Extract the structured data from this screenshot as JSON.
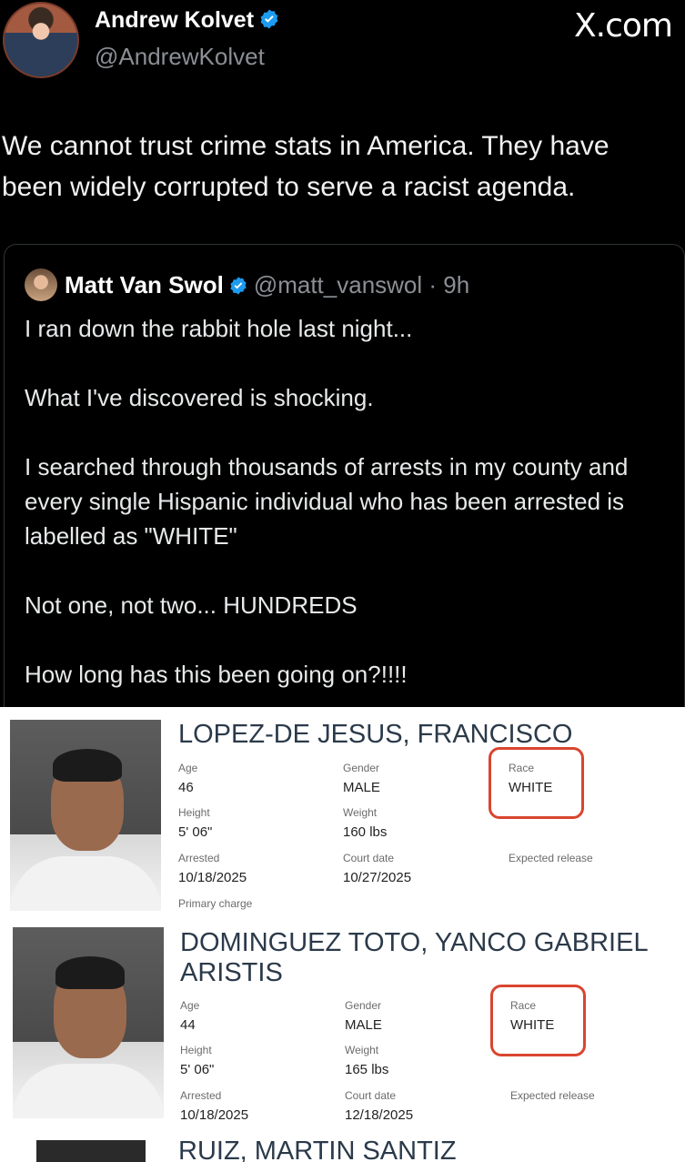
{
  "post": {
    "author_name": "Andrew Kolvet",
    "author_handle": "@AndrewKolvet",
    "brand": "X.com",
    "text_line1": "We cannot trust crime stats in America. They have",
    "text_line2": "been widely corrupted to serve a racist agenda."
  },
  "quote": {
    "author_name": "Matt Van Swol",
    "author_handle": "@matt_vanswol · 9h",
    "paragraphs": [
      "I ran down the rabbit hole last night...",
      "What I've discovered is shocking.",
      "I searched through thousands of arrests in my county and every single Hispanic individual who has been arrested is labelled as \"WHITE\"",
      "Not one, not two... HUNDREDS",
      "How long has this been going on?!!!!"
    ]
  },
  "labels": {
    "age": "Age",
    "gender": "Gender",
    "race": "Race",
    "height": "Height",
    "weight": "Weight",
    "arrested": "Arrested",
    "court_date": "Court date",
    "expected_release": "Expected release",
    "primary_charge": "Primary charge"
  },
  "records": [
    {
      "name_line1": "LOPEZ-DE JESUS, FRANCISCO",
      "name_line2": "",
      "age": "46",
      "gender": "MALE",
      "race": "WHITE",
      "height": "5' 06\"",
      "weight": "160 lbs",
      "arrested": "10/18/2025",
      "court_date": "10/27/2025"
    },
    {
      "name_line1": "DOMINGUEZ TOTO, YANCO GABRIEL",
      "name_line2": "ARISTIS",
      "age": "44",
      "gender": "MALE",
      "race": "WHITE",
      "height": "5' 06\"",
      "weight": "165 lbs",
      "arrested": "10/18/2025",
      "court_date": "12/18/2025"
    },
    {
      "name_line1": "RUIZ, MARTIN SANTIZ"
    }
  ],
  "colors": {
    "background": "#000000",
    "verified": "#1d9bf0",
    "highlight_box": "#d9452f",
    "record_name": "#2b3a4a"
  }
}
